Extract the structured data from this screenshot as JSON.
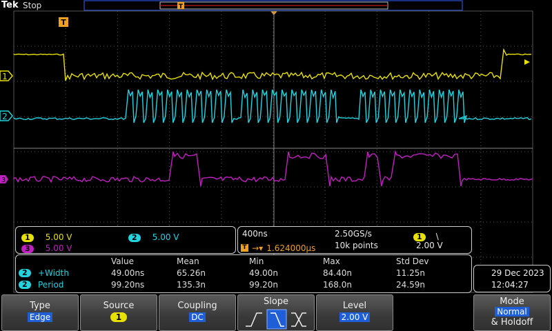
{
  "header": {
    "brand": "Tek",
    "status": "Stop",
    "trigger_marker": "T"
  },
  "trigger_flag": "T",
  "channel_markers": [
    "1",
    "2",
    "3"
  ],
  "channels": [
    {
      "id": "1",
      "scale": "5.00 V",
      "color": "#e8e000"
    },
    {
      "id": "2",
      "scale": "5.00 V",
      "color": "#22d3e0"
    },
    {
      "id": "3",
      "scale": "5.00 V",
      "color": "#c020c0"
    }
  ],
  "timebase": {
    "time_div": "400ns",
    "sample_rate": "2.50GS/s",
    "trigger_position": "1.624000µs",
    "record_length": "10k points"
  },
  "trigger_summary": {
    "source": "1",
    "slope_symbol": "\\",
    "level": "2.00 V"
  },
  "measurements": {
    "columns": [
      "Value",
      "Mean",
      "Min",
      "Max",
      "Std Dev"
    ],
    "rows": [
      {
        "channel": "2",
        "name": "+Width",
        "values": [
          "49.00ns",
          "65.26n",
          "49.00n",
          "84.40n",
          "11.25n"
        ]
      },
      {
        "channel": "2",
        "name": "Period",
        "values": [
          "99.20ns",
          "135.3n",
          "99.20n",
          "168.0n",
          "24.59n"
        ]
      }
    ]
  },
  "datetime": {
    "date": "29 Dec  2023",
    "time": "12:04:27"
  },
  "menu": {
    "type": {
      "label": "Type",
      "value": "Edge"
    },
    "source": {
      "label": "Source",
      "value": "1"
    },
    "coupling": {
      "label": "Coupling",
      "value": "DC"
    },
    "slope": {
      "label": "Slope"
    },
    "level": {
      "label": "Level",
      "value": "2.00 V"
    },
    "mode": {
      "label": "Mode",
      "value": "Normal",
      "extra": "& Holdoff"
    }
  },
  "colors": {
    "ch1": "#e8e000",
    "ch2": "#22d3e0",
    "ch3": "#c020c0",
    "trigger": "#f0a020",
    "menu_value": "#1e5fd8"
  }
}
